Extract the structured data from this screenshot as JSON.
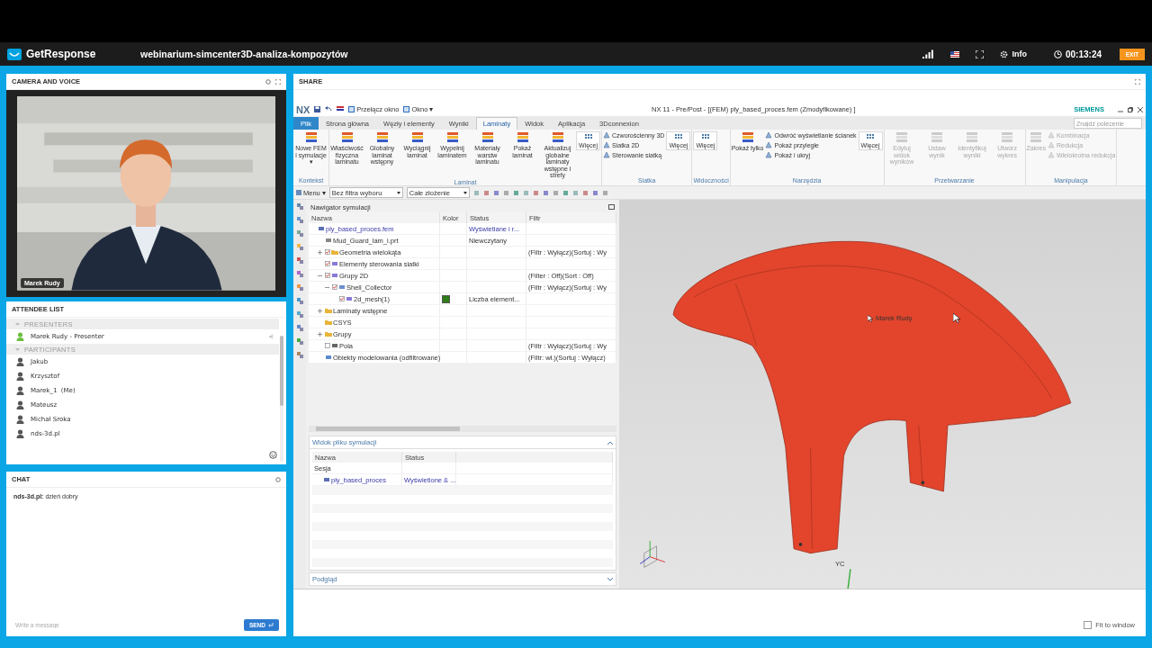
{
  "topbar": {
    "brand": "GetResponse",
    "title": "webinarium-simcenter3D-analiza-kompozytów",
    "info": "Info",
    "timer": "00:13:24",
    "exit": "EXIT"
  },
  "camera": {
    "title": "CAMERA AND VOICE",
    "speaker": "Marek Rudy"
  },
  "attendees": {
    "title": "ATTENDEE LIST",
    "groups": [
      {
        "label": "PRESENTERS",
        "expanded": true,
        "people": [
          {
            "name": "Marek Rudy - Presenter",
            "color": "#6cbf3f"
          }
        ]
      },
      {
        "label": "PARTICIPANTS",
        "expanded": true,
        "people": [
          {
            "name": "Jakub",
            "color": "#555555"
          },
          {
            "name": "Krzysztof",
            "color": "#555555"
          },
          {
            "name": "Marek_1  (Me)",
            "color": "#555555"
          },
          {
            "name": "Mateusz",
            "color": "#555555"
          },
          {
            "name": "Michał Sroka",
            "color": "#555555"
          },
          {
            "name": "nds-3d.pl",
            "color": "#555555"
          }
        ]
      }
    ]
  },
  "chat": {
    "title": "CHAT",
    "messages": [
      "**nds-3d.pl:** dzień dobry"
    ],
    "placeholder": "Write a message",
    "send": "SEND"
  },
  "share": {
    "title": "SHARE",
    "fit_to_window": {
      "label": "Fit to window",
      "checked": false
    }
  },
  "nx": {
    "logo": "NX",
    "quick_access": [
      "Przełącz okno",
      "Okno ▾"
    ],
    "title": "NX 11 - Pre/Post - [(FEM) ply_based_proces.fem (Zmodyfikowane) ]",
    "brand": "SIEMENS",
    "search_placeholder": "Znajdź polecenie",
    "tabs": [
      {
        "label": "Plik",
        "kind": "file",
        "selected": false
      },
      {
        "label": "Strona główna",
        "kind": "tab",
        "selected": false
      },
      {
        "label": "Węzły i elementy",
        "kind": "tab",
        "selected": false
      },
      {
        "label": "Wyniki",
        "kind": "tab",
        "selected": false
      },
      {
        "label": "Laminaty",
        "kind": "tab",
        "selected": true
      },
      {
        "label": "Widok",
        "kind": "tab",
        "selected": false
      },
      {
        "label": "Aplikacja",
        "kind": "tab",
        "selected": false
      },
      {
        "label": "3Dconnexion",
        "kind": "tab",
        "selected": false
      }
    ],
    "ribbon": [
      {
        "label": "Kontekst",
        "items": [
          {
            "kind": "large",
            "label": "Nowe FEM i symulacje ▾",
            "disabled": false
          }
        ]
      },
      {
        "label": "Laminat",
        "items": [
          {
            "kind": "large",
            "label": "Właściwość fizyczna laminatu",
            "disabled": false
          },
          {
            "kind": "large",
            "label": "Globalny laminat wstępny",
            "disabled": false
          },
          {
            "kind": "large",
            "label": "Wyciągnij laminat",
            "disabled": false
          },
          {
            "kind": "large",
            "label": "Wypełnij laminatem",
            "disabled": false
          },
          {
            "kind": "large",
            "label": "Materiały warstw laminatu",
            "disabled": false
          },
          {
            "kind": "large",
            "label": "Pokaż laminat",
            "disabled": false
          },
          {
            "kind": "large",
            "label": "Aktualizuj globalne laminaty wstępne i strefy",
            "disabled": false
          },
          {
            "kind": "more",
            "label": "Więcej",
            "disabled": false
          }
        ]
      },
      {
        "label": "Siatka",
        "items": [
          {
            "kind": "small",
            "label": "Czworościenny 3D",
            "disabled": false
          },
          {
            "kind": "small",
            "label": "Siatka 2D",
            "disabled": false
          },
          {
            "kind": "small",
            "label": "Sterowanie siatką",
            "disabled": false
          },
          {
            "kind": "more",
            "label": "Więcej",
            "disabled": false
          }
        ]
      },
      {
        "label": "Widoczności",
        "items": [
          {
            "kind": "more",
            "label": "Więcej",
            "disabled": false
          }
        ]
      },
      {
        "label": "Narzędzia",
        "items": [
          {
            "kind": "large",
            "label": "Pokaż tylko",
            "disabled": false
          },
          {
            "kind": "small",
            "label": "Odwróć wyświetlanie ścianek",
            "disabled": false
          },
          {
            "kind": "small",
            "label": "Pokaż przyległe",
            "disabled": false
          },
          {
            "kind": "small",
            "label": "Pokaż i ukryj",
            "disabled": false
          },
          {
            "kind": "more",
            "label": "Więcej",
            "disabled": false
          }
        ]
      },
      {
        "label": "Przetwarzanie",
        "items": [
          {
            "kind": "large",
            "label": "Edytuj widok wyników",
            "disabled": true
          },
          {
            "kind": "large",
            "label": "Ustaw wynik",
            "disabled": true
          },
          {
            "kind": "large",
            "label": "Identyfikuj wyniki",
            "disabled": true
          },
          {
            "kind": "large",
            "label": "Utwórz wykres",
            "disabled": true
          }
        ]
      },
      {
        "label": "Manipulacja",
        "items": [
          {
            "kind": "large",
            "label": "Zakres",
            "disabled": true
          },
          {
            "kind": "small",
            "label": "Kombinacja",
            "disabled": true
          },
          {
            "kind": "small",
            "label": "Redukcja",
            "disabled": true
          },
          {
            "kind": "small",
            "label": "Wielokrotna redukcja",
            "disabled": true
          }
        ]
      }
    ],
    "toolbar": {
      "menu": "Menu ▾",
      "filters": [
        "Bez filtra wyboru",
        "Całe złożenie"
      ]
    },
    "navigator": {
      "title": "Nawigator symulacji",
      "columns": [
        "Nazwa",
        "Kolor",
        "Status",
        "Filtr"
      ],
      "tree": [
        {
          "name": "ply_based_proces.fem",
          "kind": "file",
          "status": "Wyświetlane i r...",
          "children": [
            {
              "name": "Mud_Guard_lam_i.prt",
              "kind": "part",
              "status": "Niewczytany"
            },
            {
              "name": "Geometria wielokąta",
              "kind": "folder",
              "expanded": false,
              "checked": true,
              "filter": "(Filtr : Wyłącz)(Sortuj : Wy"
            },
            {
              "name": "Elementy sterowania siatki",
              "kind": "mesh",
              "checked": true
            },
            {
              "name": "Grupy 2D",
              "kind": "mesh",
              "expanded": true,
              "checked": true,
              "filter": "(Filter : Off)(Sort : Off)",
              "children": [
                {
                  "name": "Shell_Collector",
                  "kind": "collector",
                  "expanded": true,
                  "checked": true,
                  "filter": "(Filtr : Wyłącz)(Sortuj : Wy",
                  "children": [
                    {
                      "name": "2d_mesh(1)",
                      "kind": "mesh",
                      "checked": true,
                      "color": "#2e7d1a",
                      "status": "Liczba element..."
                    }
                  ]
                }
              ]
            },
            {
              "name": "Laminaty wstępne",
              "kind": "folder",
              "expanded": false
            },
            {
              "name": "CSYS",
              "kind": "folder"
            },
            {
              "name": "Grupy",
              "kind": "folder",
              "expanded": false
            },
            {
              "name": "Pola",
              "kind": "field",
              "checked": false,
              "filter": "(Filtr : Wyłącz)(Sortuj : Wy"
            },
            {
              "name": "Obiekty modelowania (odfiltrowane)",
              "kind": "objects",
              "filter": "(Filtr: wł.)(Sortuj : Wyłącz)"
            }
          ]
        }
      ]
    },
    "file_view": {
      "title": "Widok pliku symulacji",
      "expanded": true,
      "columns": [
        "Nazwa",
        "Status"
      ],
      "rows": [
        {
          "name": "Sesja",
          "children": [
            {
              "name": "ply_based_proces",
              "status": "Wyświetlone & ..."
            }
          ]
        }
      ]
    },
    "preview": {
      "title": "Podgląd",
      "expanded": false
    },
    "viewport": {
      "cursor_label": "Marek Rudy",
      "axis_label": "YC"
    }
  }
}
